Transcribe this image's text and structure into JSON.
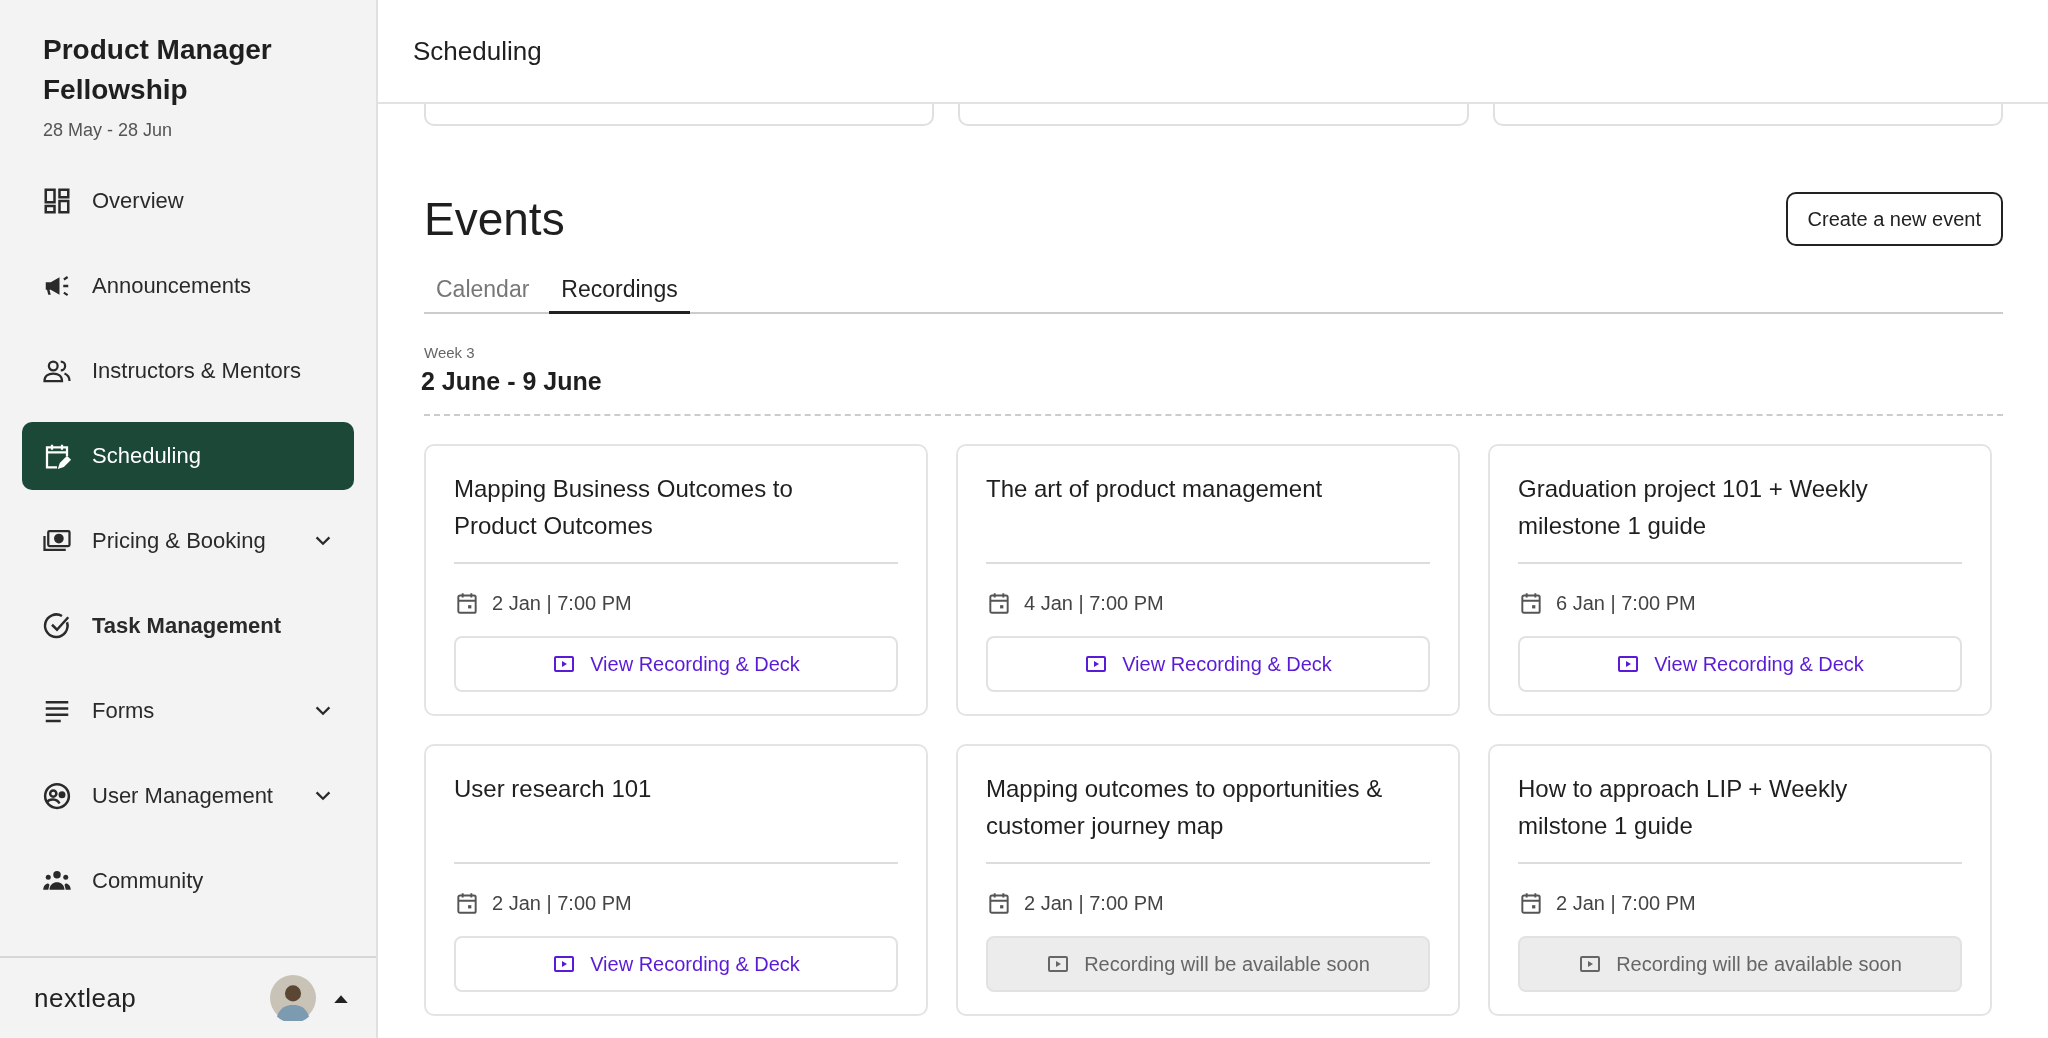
{
  "sidebar": {
    "title": "Product Manager Fellowship",
    "dates": "28 May - 28 Jun",
    "items": [
      {
        "label": "Overview",
        "kind": "dashboard",
        "selected": false,
        "expandable": false,
        "bold": false
      },
      {
        "label": "Announcements",
        "kind": "megaphone",
        "selected": false,
        "expandable": false,
        "bold": false
      },
      {
        "label": "Instructors & Mentors",
        "kind": "people",
        "selected": false,
        "expandable": false,
        "bold": false
      },
      {
        "label": "Scheduling",
        "kind": "calendar",
        "selected": true,
        "expandable": false,
        "bold": false
      },
      {
        "label": "Pricing & Booking",
        "kind": "money",
        "selected": false,
        "expandable": true,
        "bold": false
      },
      {
        "label": "Task Management",
        "kind": "check",
        "selected": false,
        "expandable": false,
        "bold": true
      },
      {
        "label": "Forms",
        "kind": "lines",
        "selected": false,
        "expandable": true,
        "bold": false
      },
      {
        "label": "User Management",
        "kind": "user",
        "selected": false,
        "expandable": true,
        "bold": false
      },
      {
        "label": "Community",
        "kind": "group",
        "selected": false,
        "expandable": false,
        "bold": false
      }
    ],
    "footer": {
      "logo": "nextleap"
    }
  },
  "header": {
    "title": "Scheduling"
  },
  "events": {
    "title": "Events",
    "create_button": "Create a new event",
    "tabs": [
      {
        "label": "Calendar",
        "selected": false
      },
      {
        "label": "Recordings",
        "selected": true
      }
    ],
    "week": {
      "label": "Week 3",
      "range": "2 June - 9 June"
    },
    "cards": [
      {
        "title": "Mapping Business Outcomes to Product Outcomes",
        "date": "2 Jan | 7:00 PM",
        "button": {
          "label": "View Recording & Deck",
          "disabled": false
        }
      },
      {
        "title": "The art of product management",
        "date": "4 Jan | 7:00 PM",
        "button": {
          "label": "View Recording & Deck",
          "disabled": false
        }
      },
      {
        "title": "Graduation project 101 + Weekly milestone 1 guide",
        "date": "6 Jan | 7:00 PM",
        "button": {
          "label": "View Recording & Deck",
          "disabled": false
        }
      },
      {
        "title": "User research 101",
        "date": "2 Jan | 7:00 PM",
        "button": {
          "label": "View Recording & Deck",
          "disabled": false
        }
      },
      {
        "title": "Mapping outcomes to opportunities & customer journey map",
        "date": "2 Jan | 7:00 PM",
        "button": {
          "label": "Recording will be available soon",
          "disabled": true
        }
      },
      {
        "title": "How to approach LIP + Weekly milstone 1 guide",
        "date": "2 Jan | 7:00 PM",
        "button": {
          "label": "Recording will be available soon",
          "disabled": true
        }
      }
    ]
  }
}
